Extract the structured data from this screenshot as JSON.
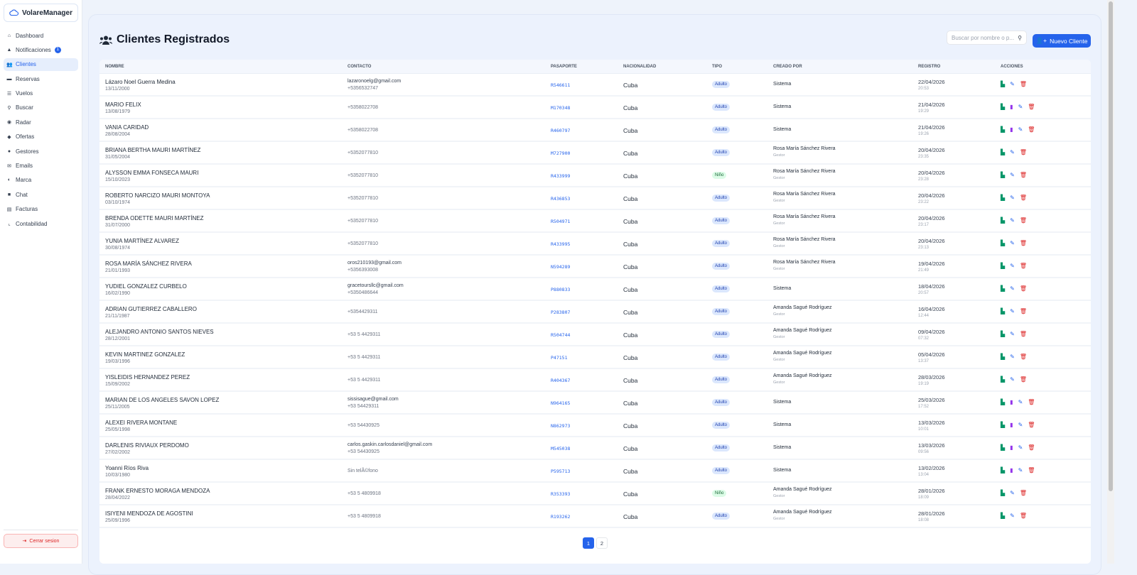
{
  "app": {
    "brand": "VolareManager"
  },
  "sidebar": {
    "items": [
      {
        "label": "Dashboard",
        "icon": "home-icon",
        "glyph": "⌂"
      },
      {
        "label": "Notificaciones",
        "icon": "bell-icon",
        "glyph": "▲",
        "badge": "1"
      },
      {
        "label": "Clientes",
        "icon": "users-icon",
        "glyph": "👥",
        "active": true
      },
      {
        "label": "Reservas",
        "icon": "ticket-icon",
        "glyph": "▬"
      },
      {
        "label": "Vuelos",
        "icon": "list-icon",
        "glyph": "☰"
      },
      {
        "label": "Buscar",
        "icon": "search-icon",
        "glyph": "⚲"
      },
      {
        "label": "Radar",
        "icon": "globe-icon",
        "glyph": "◉"
      },
      {
        "label": "Ofertas",
        "icon": "tag-icon",
        "glyph": "◆"
      },
      {
        "label": "Gestores",
        "icon": "user-gear-icon",
        "glyph": "●"
      },
      {
        "label": "Emails",
        "icon": "envelope-icon",
        "glyph": "✉"
      },
      {
        "label": "Marca",
        "icon": "palette-icon",
        "glyph": "◐"
      },
      {
        "label": "Chat",
        "icon": "comments-icon",
        "glyph": "■"
      },
      {
        "label": "Facturas",
        "icon": "invoice-icon",
        "glyph": "▤"
      },
      {
        "label": "Contabilidad",
        "icon": "chart-line-icon",
        "glyph": "⌞"
      }
    ],
    "logout": "Cerrar sesion"
  },
  "header": {
    "title": "Clientes Registrados",
    "search_placeholder": "Buscar por nombre o p...",
    "new_button": "Nuevo Cliente"
  },
  "table": {
    "columns": [
      "NOMBRE",
      "CONTACTO",
      "PASAPORTE",
      "NACIONALIDAD",
      "TIPO",
      "CREADO POR",
      "REGISTRO",
      "ACCIONES"
    ],
    "rows": [
      {
        "name": "Lázaro Noel Guerra Medina",
        "dob": "13/11/2000",
        "email": "lazaronoelg@gmail.com",
        "phone": "+5356532747",
        "passport": "R546611",
        "nat": "Cuba",
        "tipo": "Adulto",
        "by": "Sistema",
        "role": "",
        "date": "22/04/2026",
        "time": "20:53",
        "pdf": false
      },
      {
        "name": "MARIO FELIX",
        "dob": "13/08/1979",
        "email": "",
        "phone": "+5358022708",
        "passport": "M170348",
        "nat": "Cuba",
        "tipo": "Adulto",
        "by": "Sistema",
        "role": "",
        "date": "21/04/2026",
        "time": "19:29",
        "pdf": true
      },
      {
        "name": "VANIA CARIDAD",
        "dob": "28/08/2004",
        "email": "",
        "phone": "+5358022708",
        "passport": "R460797",
        "nat": "Cuba",
        "tipo": "Adulto",
        "by": "Sistema",
        "role": "",
        "date": "21/04/2026",
        "time": "19:26",
        "pdf": true
      },
      {
        "name": "BRIANA BERTHA MAURI MARTÍNEZ",
        "dob": "31/05/2004",
        "email": "",
        "phone": "+5352077810",
        "passport": "M727900",
        "nat": "Cuba",
        "tipo": "Adulto",
        "by": "Rosa María Sánchez Rivera",
        "role": "Gestor",
        "date": "20/04/2026",
        "time": "23:35",
        "pdf": false
      },
      {
        "name": "ALYSSON EMMA FONSECA MAURI",
        "dob": "15/10/2023",
        "email": "",
        "phone": "+5352077810",
        "passport": "R433999",
        "nat": "Cuba",
        "tipo": "Niño",
        "by": "Rosa María Sánchez Rivera",
        "role": "Gestor",
        "date": "20/04/2026",
        "time": "23:28",
        "pdf": false
      },
      {
        "name": "ROBERTO NARCIZO MAURI MONTOYA",
        "dob": "03/10/1974",
        "email": "",
        "phone": "+5352077810",
        "passport": "R436853",
        "nat": "Cuba",
        "tipo": "Adulto",
        "by": "Rosa María Sánchez Rivera",
        "role": "Gestor",
        "date": "20/04/2026",
        "time": "23:22",
        "pdf": false
      },
      {
        "name": "BRENDA ODETTE MAURI MARTÍNEZ",
        "dob": "31/07/2000",
        "email": "",
        "phone": "+5352077810",
        "passport": "R504971",
        "nat": "Cuba",
        "tipo": "Adulto",
        "by": "Rosa María Sánchez Rivera",
        "role": "Gestor",
        "date": "20/04/2026",
        "time": "23:17",
        "pdf": false
      },
      {
        "name": "YUNIA MARTÍNEZ ALVAREZ",
        "dob": "30/08/1974",
        "email": "",
        "phone": "+5352077810",
        "passport": "R433995",
        "nat": "Cuba",
        "tipo": "Adulto",
        "by": "Rosa María Sánchez Rivera",
        "role": "Gestor",
        "date": "20/04/2026",
        "time": "23:13",
        "pdf": false
      },
      {
        "name": "ROSA MARÍA SÁNCHEZ RIVERA",
        "dob": "21/01/1993",
        "email": "oros210193@gmail.com",
        "phone": "+5356393008",
        "passport": "N594289",
        "nat": "Cuba",
        "tipo": "Adulto",
        "by": "Rosa María Sánchez Rivera",
        "role": "Gestor",
        "date": "19/04/2026",
        "time": "21:49",
        "pdf": false
      },
      {
        "name": "YUDIEL GONZALEZ CURBELO",
        "dob": "16/02/1990",
        "email": "gracetoursllc@gmail.com",
        "phone": "+5350486644",
        "passport": "P880833",
        "nat": "Cuba",
        "tipo": "Adulto",
        "by": "Sistema",
        "role": "",
        "date": "18/04/2026",
        "time": "20:57",
        "pdf": false
      },
      {
        "name": "ADRIAN GUTIERREZ CABALLERO",
        "dob": "21/11/1987",
        "email": "",
        "phone": "+5354429311",
        "passport": "P283807",
        "nat": "Cuba",
        "tipo": "Adulto",
        "by": "Amanda Sagué Rodríguez",
        "role": "Gestor",
        "date": "16/04/2026",
        "time": "12:44",
        "pdf": false
      },
      {
        "name": "ALEJANDRO ANTONIO SANTOS NIEVES",
        "dob": "28/12/2001",
        "email": "",
        "phone": "+53 5 4429311",
        "passport": "R504744",
        "nat": "Cuba",
        "tipo": "Adulto",
        "by": "Amanda Sagué Rodríguez",
        "role": "Gestor",
        "date": "09/04/2026",
        "time": "07:32",
        "pdf": false
      },
      {
        "name": "KEVIN MARTINEZ GONZALEZ",
        "dob": "19/03/1996",
        "email": "",
        "phone": "+53 5 4429311",
        "passport": "P47151",
        "nat": "Cuba",
        "tipo": "Adulto",
        "by": "Amanda Sagué Rodríguez",
        "role": "Gestor",
        "date": "05/04/2026",
        "time": "13:37",
        "pdf": false
      },
      {
        "name": "YISLEIDIS HERNANDEZ PEREZ",
        "dob": "15/09/2002",
        "email": "",
        "phone": "+53 5 4429311",
        "passport": "R404367",
        "nat": "Cuba",
        "tipo": "Adulto",
        "by": "Amanda Sagué Rodríguez",
        "role": "Gestor",
        "date": "28/03/2026",
        "time": "19:19",
        "pdf": false
      },
      {
        "name": "MARIAN DE LOS ANGELES SAVON LOPEZ",
        "dob": "25/11/2005",
        "email": "sissisague@gmail.com",
        "phone": "+53 54429311",
        "passport": "N964165",
        "nat": "Cuba",
        "tipo": "Adulto",
        "by": "Sistema",
        "role": "",
        "date": "25/03/2026",
        "time": "17:52",
        "pdf": true
      },
      {
        "name": "ALEXEI RIVERA MONTANE",
        "dob": "25/05/1998",
        "email": "",
        "phone": "+53 54430925",
        "passport": "N862973",
        "nat": "Cuba",
        "tipo": "Adulto",
        "by": "Sistema",
        "role": "",
        "date": "13/03/2026",
        "time": "10:01",
        "pdf": true
      },
      {
        "name": "DARLENIS RIVIAUX PERDOMO",
        "dob": "27/02/2002",
        "email": "carlos.gaskin.carlosdaniel@gmail.com",
        "phone": "+53 54430925",
        "passport": "M545038",
        "nat": "Cuba",
        "tipo": "Adulto",
        "by": "Sistema",
        "role": "",
        "date": "13/03/2026",
        "time": "09:56",
        "pdf": true
      },
      {
        "name": "Yoanni Ríos Riva",
        "dob": "10/03/1980",
        "email": "",
        "phone": "Sin telÃ©fono",
        "passport": "P595713",
        "nat": "Cuba",
        "tipo": "Adulto",
        "by": "Sistema",
        "role": "",
        "date": "13/02/2026",
        "time": "13:04",
        "pdf": true
      },
      {
        "name": "FRANK ERNESTO MORAGA MENDOZA",
        "dob": "28/04/2022",
        "email": "",
        "phone": "+53 5 4809918",
        "passport": "R353393",
        "nat": "Cuba",
        "tipo": "Niño",
        "by": "Amanda Sagué Rodríguez",
        "role": "Gestor",
        "date": "28/01/2026",
        "time": "18:09",
        "pdf": false
      },
      {
        "name": "ISIYENI MENDOZA DE AGOSTINI",
        "dob": "25/09/1996",
        "email": "",
        "phone": "+53 5 4809918",
        "passport": "R193262",
        "nat": "Cuba",
        "tipo": "Adulto",
        "by": "Amanda Sagué Rodríguez",
        "role": "Gestor",
        "date": "28/01/2026",
        "time": "18:08",
        "pdf": false
      }
    ]
  },
  "pagination": {
    "pages": [
      "1",
      "2"
    ],
    "current": "1"
  },
  "colors": {
    "accent": "#2563eb",
    "excel": "#059669",
    "pdf": "#9333ea",
    "delete": "#dc2626"
  }
}
